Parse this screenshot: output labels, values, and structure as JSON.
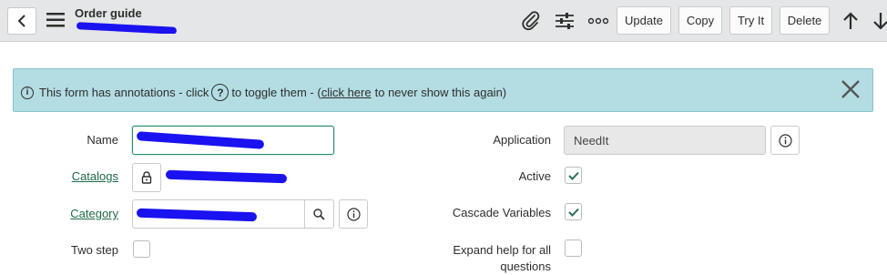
{
  "header": {
    "title": "Order guide",
    "buttons": {
      "update": "Update",
      "copy": "Copy",
      "try_it": "Try It",
      "delete": "Delete"
    }
  },
  "banner": {
    "text_before": "This form has annotations - click",
    "text_toggle": "to toggle them - (",
    "link_text": "click here",
    "text_after": "to never show this again)"
  },
  "form": {
    "name_label": "Name",
    "catalogs_label": "Catalogs",
    "category_label": "Category",
    "two_step_label": "Two step",
    "application_label": "Application",
    "application_value": "NeedIt",
    "active_label": "Active",
    "active_checked": true,
    "cascade_label": "Cascade Variables",
    "cascade_checked": true,
    "expand_help_label_line1": "Expand help for all",
    "expand_help_label_line2": "questions",
    "expand_help_checked": false,
    "two_step_checked": false
  },
  "colors": {
    "header_bg": "#e4e6e7",
    "banner_bg": "#b3dde3",
    "link": "#1e6b47",
    "focus": "#2a8a6e"
  }
}
